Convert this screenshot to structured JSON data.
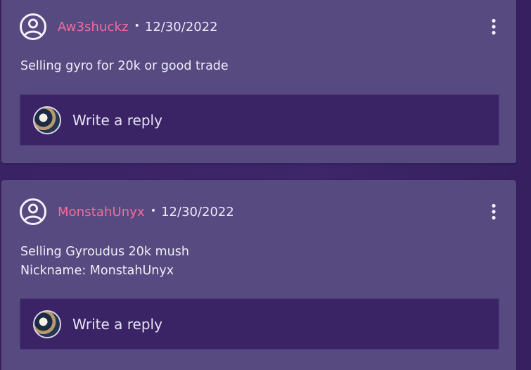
{
  "colors": {
    "page_background": "#3b2466",
    "card_background": "#564a80",
    "username": "#f36d9b",
    "reply_box": "#3b2466",
    "text": "#ece8f6"
  },
  "posts": [
    {
      "author": "Aw3shuckz",
      "separator": "•",
      "date": "12/30/2022",
      "body": [
        "Selling gyro for 20k or good trade"
      ],
      "reply_placeholder": "Write a reply",
      "author_icon": "user-circle-icon",
      "menu_icon": "more-vertical-icon"
    },
    {
      "author": "MonstahUnyx",
      "separator": "•",
      "date": "12/30/2022",
      "body": [
        "Selling Gyroudus 20k mush",
        "Nickname: MonstahUnyx"
      ],
      "reply_placeholder": "Write a reply",
      "author_icon": "user-circle-icon",
      "menu_icon": "more-vertical-icon"
    }
  ]
}
